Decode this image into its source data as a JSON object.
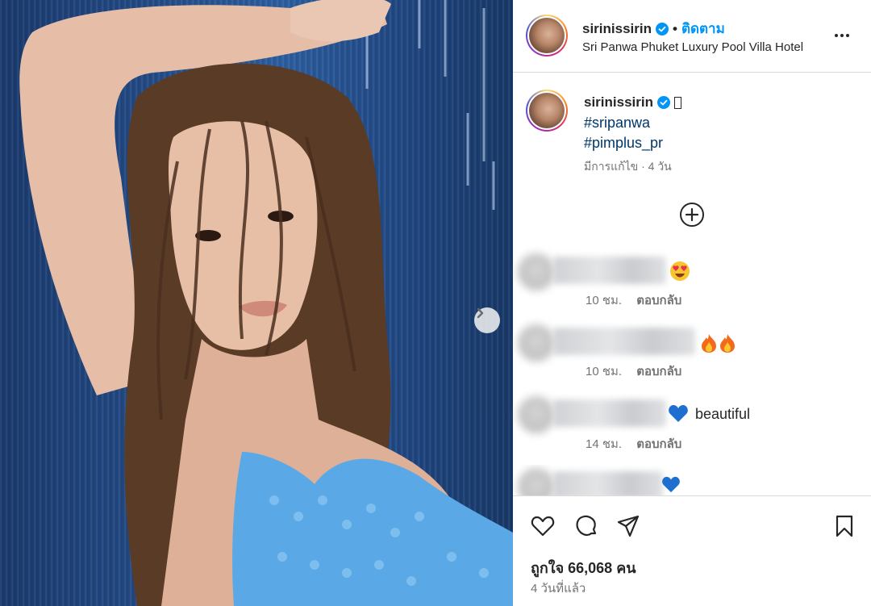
{
  "header": {
    "username": "sirinissirin",
    "follow_label": "ติดตาม",
    "location": "Sri Panwa Phuket Luxury Pool Villa Hotel"
  },
  "caption": {
    "username": "sirinissirin",
    "hashtags": [
      "#sripanwa",
      "#pimplus_pr"
    ],
    "meta": "มีการแก้ไข · 4 วัน"
  },
  "comments": [
    {
      "text": "",
      "emoji": "heart-eyes",
      "time": "10 ชม.",
      "reply": "ตอบกลับ"
    },
    {
      "text": "",
      "emoji": "fire-fire",
      "time": "10 ชม.",
      "reply": "ตอบกลับ"
    },
    {
      "text": "beautiful",
      "emoji": "blue-heart",
      "time": "14 ชม.",
      "reply": "ตอบกลับ"
    },
    {
      "text": "",
      "emoji": "blue-heart",
      "time": "",
      "reply": ""
    }
  ],
  "stats": {
    "likes": "ถูกใจ 66,068 คน",
    "time_ago": "4 วันที่แล้ว"
  },
  "colors": {
    "accent": "#0095f6",
    "hashtag": "#00376b",
    "secondary_text": "#737373"
  }
}
